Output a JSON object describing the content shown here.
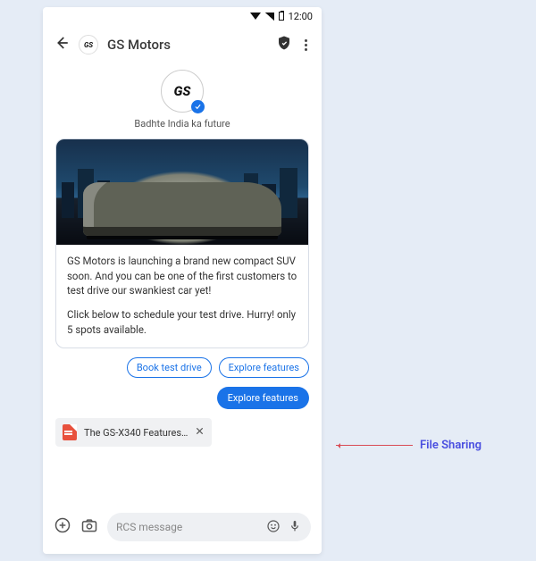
{
  "status": {
    "time": "12:00"
  },
  "header": {
    "logo_text": "GS",
    "title": "GS Motors"
  },
  "profile": {
    "logo_text": "GS",
    "tagline": "Badhte India ka future"
  },
  "card": {
    "paragraph1": "GS Motors is launching a brand new compact SUV soon. And you can be one of the first customers to test drive our swankiest car yet!",
    "paragraph2": "Click below to schedule your test drive. Hurry! only 5 spots available."
  },
  "suggestions": {
    "book": "Book test drive",
    "explore": "Explore features"
  },
  "sent": {
    "text": "Explore features"
  },
  "file": {
    "name": "The GS-X340 Features…"
  },
  "composer": {
    "placeholder": "RCS message"
  },
  "annotation": {
    "label": "File Sharing"
  }
}
